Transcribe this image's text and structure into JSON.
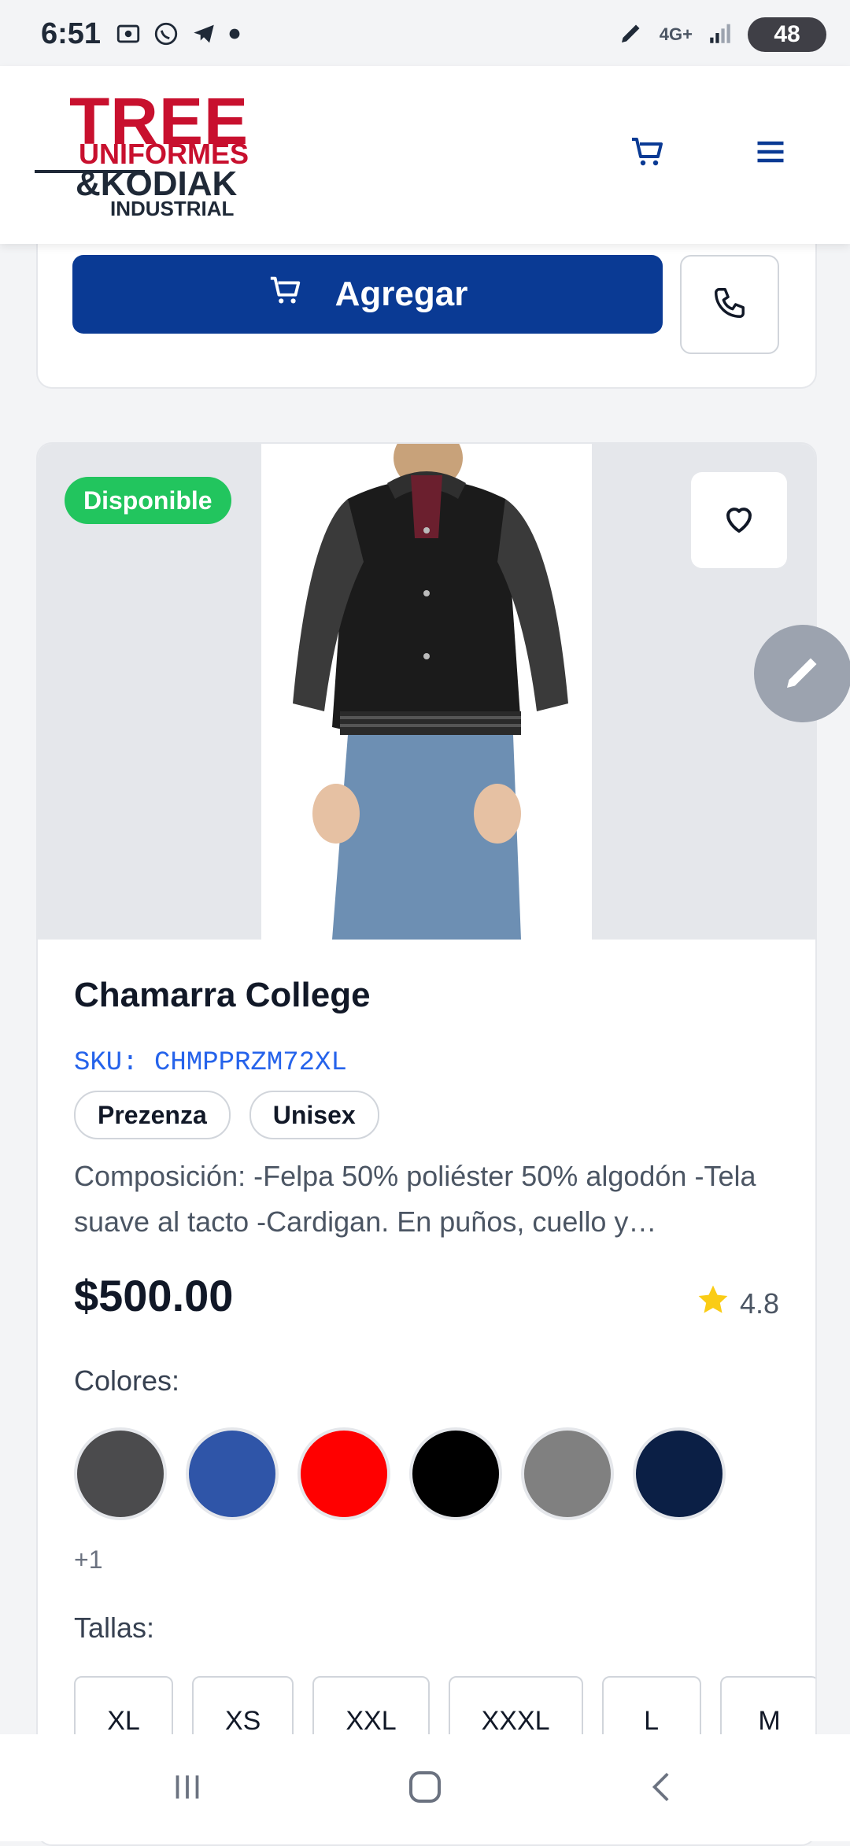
{
  "status_bar": {
    "time": "6:51",
    "network": "4G+",
    "battery": "48",
    "icons": [
      "screenshot-icon",
      "whatsapp-icon",
      "telegram-icon",
      "dot-icon",
      "pen-icon",
      "signal-icon"
    ]
  },
  "header": {
    "logo": {
      "line1": "TREE",
      "line2": "UNIFORMES",
      "line3": "&KODIAK",
      "line4": "INDUSTRIAL"
    },
    "icons": [
      "cart-icon",
      "menu-icon"
    ]
  },
  "top_card": {
    "add_label": "Agregar"
  },
  "product": {
    "availability": "Disponible",
    "title": "Chamarra College",
    "sku": "SKU: CHMPPRZM72XL",
    "tags": [
      "Prezenza",
      "Unisex"
    ],
    "description": "Composición: -Felpa 50% poliéster 50% algodón -Tela suave al tacto -Cardigan. En puños, cuello y…",
    "price": "$500.00",
    "rating": "4.8",
    "colors_label": "Colores:",
    "colors": [
      "#4b4b4d",
      "#2f55a8",
      "#ff0000",
      "#000000",
      "#808080",
      "#0b1f45"
    ],
    "more_colors": "+1",
    "sizes_label": "Tallas:",
    "sizes": [
      "XL",
      "XS",
      "XXL",
      "XXXL",
      "L",
      "M"
    ]
  },
  "accent_colors": {
    "primary": "#0a3a94",
    "available": "#22c55e",
    "sku": "#2563eb"
  }
}
